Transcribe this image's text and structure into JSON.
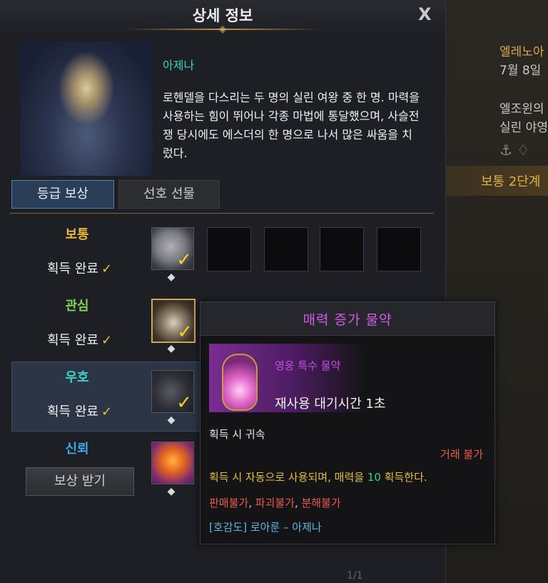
{
  "header": {
    "title": "상세 정보",
    "close_label": "X"
  },
  "character": {
    "name": "아제나",
    "description": "로헨델을 다스리는 두 명의 실린 여왕 중 한 명. 마력을 사용하는 힘이 뛰어나 각종 마법에 통달했으며, 사슬전쟁 당시에도 에스더의 한 명으로 나서 많은 싸움을 치렀다."
  },
  "tabs": [
    {
      "label": "등급 보상",
      "active": true
    },
    {
      "label": "선호 선물",
      "active": false
    }
  ],
  "tiers": [
    {
      "label": "보통",
      "color": "#e8b63c",
      "status": "획득 완료",
      "checkmark": "✓",
      "item": "coin-icon"
    },
    {
      "label": "관심",
      "color": "#7fd15a",
      "status": "획득 완료",
      "checkmark": "✓",
      "item": "potion-icon"
    },
    {
      "label": "우호",
      "color": "#3fd2c6",
      "status": "획득 완료",
      "checkmark": "✓",
      "item": "flask-icon"
    },
    {
      "label": "신뢰",
      "color": "#3ca8ee",
      "button": "보상 받기",
      "item": "orb-icon"
    }
  ],
  "tooltip": {
    "title": "매력 증가 물약",
    "type": "영웅 특수 물약",
    "cooldown": "재사용 대기시간 1초",
    "bind": "획득 시 귀속",
    "trade": "거래 불가",
    "effect_prefix": "획득 시 자동으로 사용되며, 매력을 ",
    "effect_value": "10",
    "effect_suffix": " 획득한다.",
    "flags": [
      "판매불가",
      "파괴불가",
      "분해불가"
    ],
    "flag_separator": ", ",
    "link": "[호감도] 로아룬 – 아제나"
  },
  "background": {
    "name": "엘레노아",
    "date": "7월 8일",
    "line1": "엘조윈의",
    "line2": "실린 야영",
    "band": "보통 2단계"
  },
  "colors": {
    "accent_gold": "#c9a55a",
    "tooltip_title": "#d25ae8",
    "check": "#e6c738",
    "red": "#e85a4a",
    "green": "#3dd07a"
  }
}
